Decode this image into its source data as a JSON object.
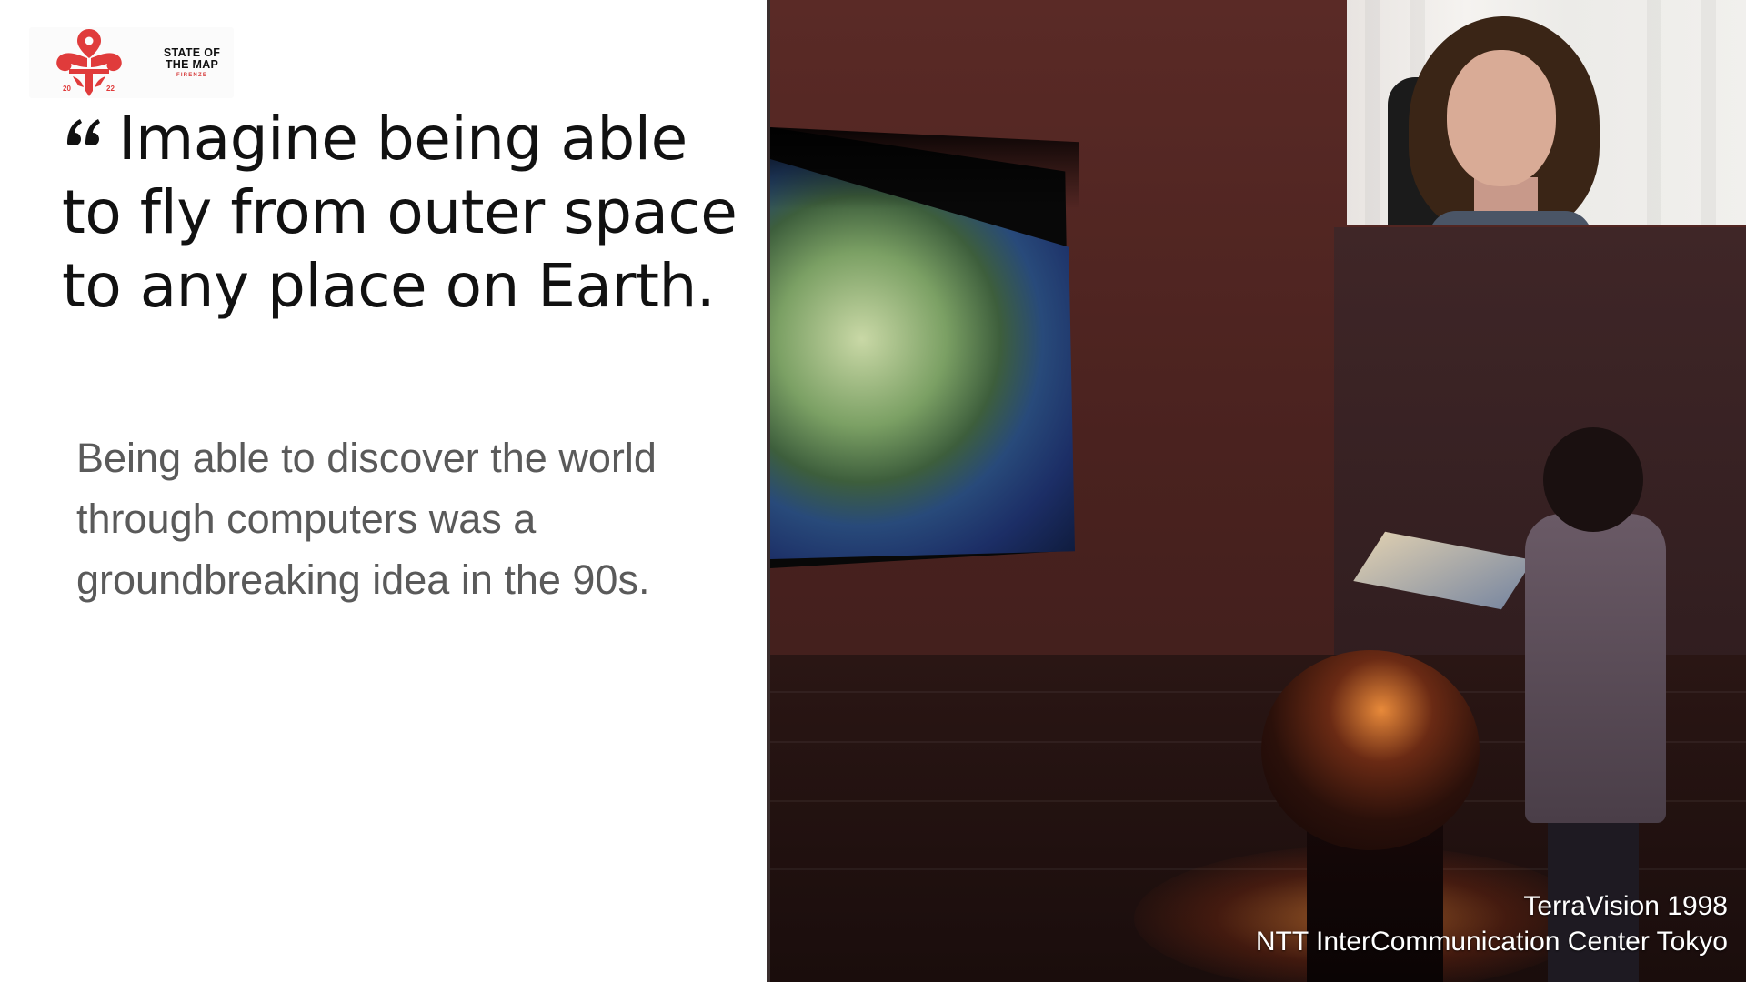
{
  "slide": {
    "logo": {
      "title_line1": "STATE OF",
      "title_line2": "THE MAP",
      "subtitle": "FIRENZE",
      "year_left": "20",
      "year_right": "22",
      "brand_color": "#e03b3b"
    },
    "quote": "Imagine being able to fly from outer space to any place on Earth.",
    "quote_icon": "quote-open-icon",
    "body": "Being able to discover the world through computers was a groundbreaking idea in the 90s."
  },
  "photo": {
    "caption_line1": "TerraVision 1998",
    "caption_line2": "NTT InterCommunication Center Tokyo"
  },
  "colors": {
    "quote_text": "#111111",
    "body_text": "#5a5a5a",
    "divider": "#3a2f2f"
  }
}
